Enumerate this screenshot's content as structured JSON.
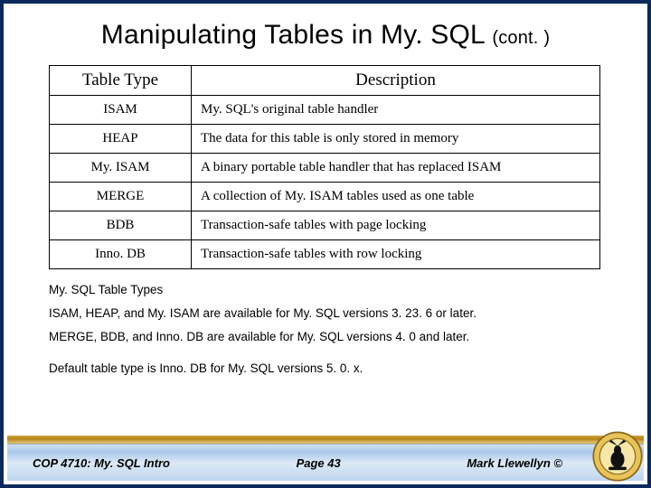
{
  "title": {
    "main": "Manipulating Tables in My. SQL",
    "suffix": "(cont. )"
  },
  "table": {
    "headers": {
      "col1": "Table Type",
      "col2": "Description"
    },
    "rows": [
      {
        "type": "ISAM",
        "desc": "My. SQL's original table handler"
      },
      {
        "type": "HEAP",
        "desc": "The data for this table is only stored in memory"
      },
      {
        "type": "My. ISAM",
        "desc": "A binary portable table handler that has replaced ISAM"
      },
      {
        "type": "MERGE",
        "desc": "A collection of My. ISAM tables used as one table"
      },
      {
        "type": "BDB",
        "desc": "Transaction-safe tables with page locking"
      },
      {
        "type": "Inno. DB",
        "desc": "Transaction-safe tables with row locking"
      }
    ]
  },
  "notes": {
    "heading": "My. SQL Table Types",
    "line1": "ISAM, HEAP, and My. ISAM are available for My. SQL versions 3. 23. 6 or later.",
    "line2": "MERGE, BDB, and Inno. DB are available for My. SQL versions 4. 0 and later.",
    "line3": "Default table type is Inno. DB for My. SQL versions 5. 0. x."
  },
  "footer": {
    "course": "COP 4710: My. SQL Intro",
    "page": "Page 43",
    "author": "Mark Llewellyn ©"
  },
  "chart_data": {
    "type": "table",
    "title": "My. SQL Table Types",
    "columns": [
      "Table Type",
      "Description"
    ],
    "rows": [
      [
        "ISAM",
        "My. SQL's original table handler"
      ],
      [
        "HEAP",
        "The data for this table is only stored in memory"
      ],
      [
        "My. ISAM",
        "A binary portable table handler that has replaced ISAM"
      ],
      [
        "MERGE",
        "A collection of My. ISAM tables used as one table"
      ],
      [
        "BDB",
        "Transaction-safe tables with page locking"
      ],
      [
        "Inno. DB",
        "Transaction-safe tables with row locking"
      ]
    ]
  }
}
